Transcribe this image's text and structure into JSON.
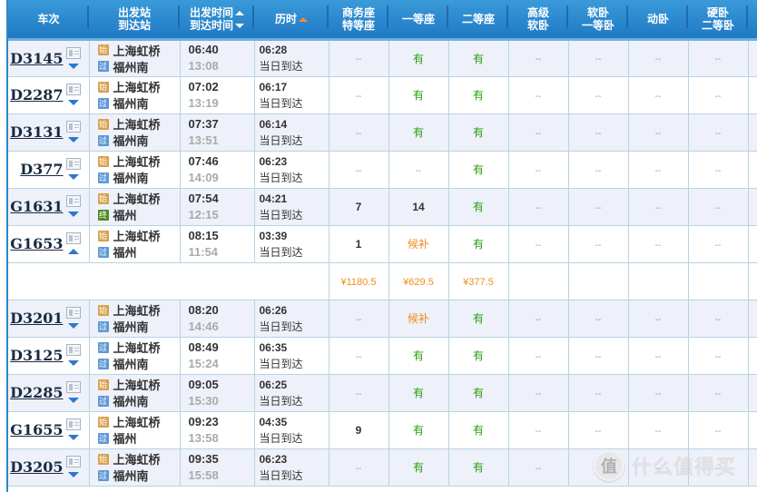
{
  "header": {
    "columns": [
      {
        "line1": "车次",
        "line2": ""
      },
      {
        "line1": "出发站",
        "line2": "到达站"
      },
      {
        "line1": "出发时间",
        "line2": "到达时间"
      },
      {
        "line1": "历时",
        "line2": ""
      },
      {
        "line1": "商务座",
        "line2": "特等座"
      },
      {
        "line1": "一等座",
        "line2": ""
      },
      {
        "line1": "二等座",
        "line2": ""
      },
      {
        "line1": "高级",
        "line2": "软卧"
      },
      {
        "line1": "软卧",
        "line2": "一等卧"
      },
      {
        "line1": "动卧",
        "line2": ""
      },
      {
        "line1": "硬卧",
        "line2": "二等卧"
      },
      {
        "line1": "",
        "line2": ""
      }
    ]
  },
  "tags": {
    "start": "始",
    "pass": "过",
    "end": "终"
  },
  "none": "--",
  "rows": [
    {
      "train": "D3145",
      "expand": "down",
      "from_tag": "start",
      "from": "上海虹桥",
      "to_tag": "pass",
      "to": "福州南",
      "dep": "06:40",
      "arr": "13:08",
      "duration": "06:28",
      "arrive_note": "当日到达",
      "seats": [
        "--",
        "有",
        "有",
        "--",
        "--",
        "--",
        "--"
      ]
    },
    {
      "train": "D2287",
      "expand": "down",
      "from_tag": "start",
      "from": "上海虹桥",
      "to_tag": "pass",
      "to": "福州南",
      "dep": "07:02",
      "arr": "13:19",
      "duration": "06:17",
      "arrive_note": "当日到达",
      "seats": [
        "--",
        "有",
        "有",
        "--",
        "--",
        "--",
        "--"
      ]
    },
    {
      "train": "D3131",
      "expand": "down",
      "from_tag": "start",
      "from": "上海虹桥",
      "to_tag": "pass",
      "to": "福州南",
      "dep": "07:37",
      "arr": "13:51",
      "duration": "06:14",
      "arrive_note": "当日到达",
      "seats": [
        "--",
        "有",
        "有",
        "--",
        "--",
        "--",
        "--"
      ]
    },
    {
      "train": "D377",
      "expand": "down",
      "from_tag": "start",
      "from": "上海虹桥",
      "to_tag": "pass",
      "to": "福州南",
      "dep": "07:46",
      "arr": "14:09",
      "duration": "06:23",
      "arrive_note": "当日到达",
      "seats": [
        "--",
        "--",
        "有",
        "--",
        "--",
        "--",
        "--"
      ]
    },
    {
      "train": "G1631",
      "expand": "down",
      "from_tag": "start",
      "from": "上海虹桥",
      "to_tag": "end",
      "to": "福州",
      "dep": "07:54",
      "arr": "12:15",
      "duration": "04:21",
      "arrive_note": "当日到达",
      "seats": [
        "7",
        "14",
        "有",
        "--",
        "--",
        "--",
        "--"
      ]
    },
    {
      "train": "G1653",
      "expand": "up",
      "from_tag": "start",
      "from": "上海虹桥",
      "to_tag": "pass",
      "to": "福州",
      "dep": "08:15",
      "arr": "11:54",
      "duration": "03:39",
      "arrive_note": "当日到达",
      "seats": [
        "1",
        "候补",
        "有",
        "--",
        "--",
        "--",
        "--"
      ],
      "prices": [
        "¥1180.5",
        "¥629.5",
        "¥377.5",
        "",
        "",
        "",
        ""
      ]
    },
    {
      "train": "D3201",
      "expand": "down",
      "from_tag": "start",
      "from": "上海虹桥",
      "to_tag": "pass",
      "to": "福州南",
      "dep": "08:20",
      "arr": "14:46",
      "duration": "06:26",
      "arrive_note": "当日到达",
      "seats": [
        "--",
        "候补",
        "有",
        "--",
        "--",
        "--",
        "--"
      ]
    },
    {
      "train": "D3125",
      "expand": "down",
      "from_tag": "pass",
      "from": "上海虹桥",
      "to_tag": "pass",
      "to": "福州南",
      "dep": "08:49",
      "arr": "15:24",
      "duration": "06:35",
      "arrive_note": "当日到达",
      "seats": [
        "--",
        "有",
        "有",
        "--",
        "--",
        "--",
        "--"
      ]
    },
    {
      "train": "D2285",
      "expand": "down",
      "from_tag": "start",
      "from": "上海虹桥",
      "to_tag": "pass",
      "to": "福州南",
      "dep": "09:05",
      "arr": "15:30",
      "duration": "06:25",
      "arrive_note": "当日到达",
      "seats": [
        "--",
        "有",
        "有",
        "--",
        "--",
        "--",
        "--"
      ]
    },
    {
      "train": "G1655",
      "expand": "down",
      "from_tag": "start",
      "from": "上海虹桥",
      "to_tag": "pass",
      "to": "福州",
      "dep": "09:23",
      "arr": "13:58",
      "duration": "04:35",
      "arrive_note": "当日到达",
      "seats": [
        "9",
        "有",
        "有",
        "--",
        "--",
        "--",
        "--"
      ]
    },
    {
      "train": "D3205",
      "expand": "down",
      "from_tag": "start",
      "from": "上海虹桥",
      "to_tag": "pass",
      "to": "福州南",
      "dep": "09:35",
      "arr": "15:58",
      "duration": "06:23",
      "arrive_note": "当日到达",
      "seats": [
        "--",
        "有",
        "有",
        "--",
        "--",
        "--",
        "--"
      ]
    }
  ],
  "watermark": {
    "badge": "值",
    "text": "什么值得买"
  }
}
